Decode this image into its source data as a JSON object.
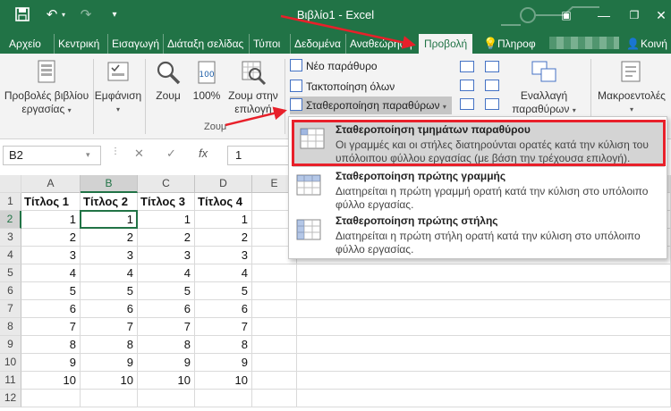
{
  "window": {
    "title": "Βιβλίο1 - Excel",
    "colors": {
      "excel_green": "#217346",
      "annotation_red": "#e8202a"
    }
  },
  "quick_access": [
    "save-icon",
    "undo-icon",
    "redo-icon",
    "customize-icon"
  ],
  "tabs": [
    {
      "label": "Αρχείο"
    },
    {
      "label": "Κεντρική"
    },
    {
      "label": "Εισαγωγή"
    },
    {
      "label": "Διάταξη σελίδας"
    },
    {
      "label": "Τύποι"
    },
    {
      "label": "Δεδομένα"
    },
    {
      "label": "Αναθεώρηση"
    },
    {
      "label": "Προβολή",
      "active": true
    },
    {
      "label": "Πληροφ"
    },
    {
      "label": "Κοινή"
    }
  ],
  "ribbon": {
    "workbook_views": {
      "label": "Προβολές βιβλίου",
      "label2": "εργασίας"
    },
    "show": {
      "label": "Εμφάνιση"
    },
    "zoom": {
      "label": "Ζουμ"
    },
    "zoom_100": {
      "label": "100%"
    },
    "zoom_selection": {
      "label": "Ζουμ στην",
      "label2": "επιλογή"
    },
    "zoom_group": "Ζουμ",
    "new_window": "Νέο παράθυρο",
    "arrange_all": "Τακτοποίηση όλων",
    "freeze_panes": "Σταθεροποίηση παραθύρων",
    "switch_windows": {
      "label": "Εναλλαγή",
      "label2": "παραθύρων"
    },
    "macros": {
      "label": "Μακροεντολές"
    }
  },
  "formula_bar": {
    "name_box": "B2",
    "value": "1"
  },
  "sheet": {
    "columns": [
      "A",
      "B",
      "C",
      "D",
      "E"
    ],
    "headers": [
      "Τίτλος 1",
      "Τίτλος 2",
      "Τίτλος 3",
      "Τίτλος 4"
    ],
    "rows": [
      [
        1,
        1,
        1,
        1
      ],
      [
        2,
        2,
        2,
        2
      ],
      [
        3,
        3,
        3,
        3
      ],
      [
        4,
        4,
        4,
        4
      ],
      [
        5,
        5,
        5,
        5
      ],
      [
        6,
        6,
        6,
        6
      ],
      [
        7,
        7,
        7,
        7
      ],
      [
        8,
        8,
        8,
        8
      ],
      [
        9,
        9,
        9,
        9
      ],
      [
        10,
        10,
        10,
        10
      ]
    ],
    "row_numbers": [
      "1",
      "2",
      "3",
      "4",
      "5",
      "6",
      "7",
      "8",
      "9",
      "10",
      "11",
      "12"
    ],
    "selected_cell": "B2"
  },
  "freeze_menu": [
    {
      "title": "Σταθεροποίηση τμημάτων παραθύρου",
      "desc": "Οι γραμμές και οι στήλες διατηρούνται ορατές κατά την κύλιση του υπόλοιπου φύλλου εργασίας (με βάση την τρέχουσα επιλογή).",
      "highlighted": true
    },
    {
      "title": "Σταθεροποίηση πρώτης γραμμής",
      "desc": "Διατηρείται η πρώτη γραμμή ορατή κατά την κύλιση στο υπόλοιπο φύλλο εργασίας."
    },
    {
      "title": "Σταθεροποίηση πρώτης στήλης",
      "desc": "Διατηρείται η πρώτη στήλη ορατή κατά την κύλιση στο υπόλοιπο φύλλο εργασίας."
    }
  ]
}
